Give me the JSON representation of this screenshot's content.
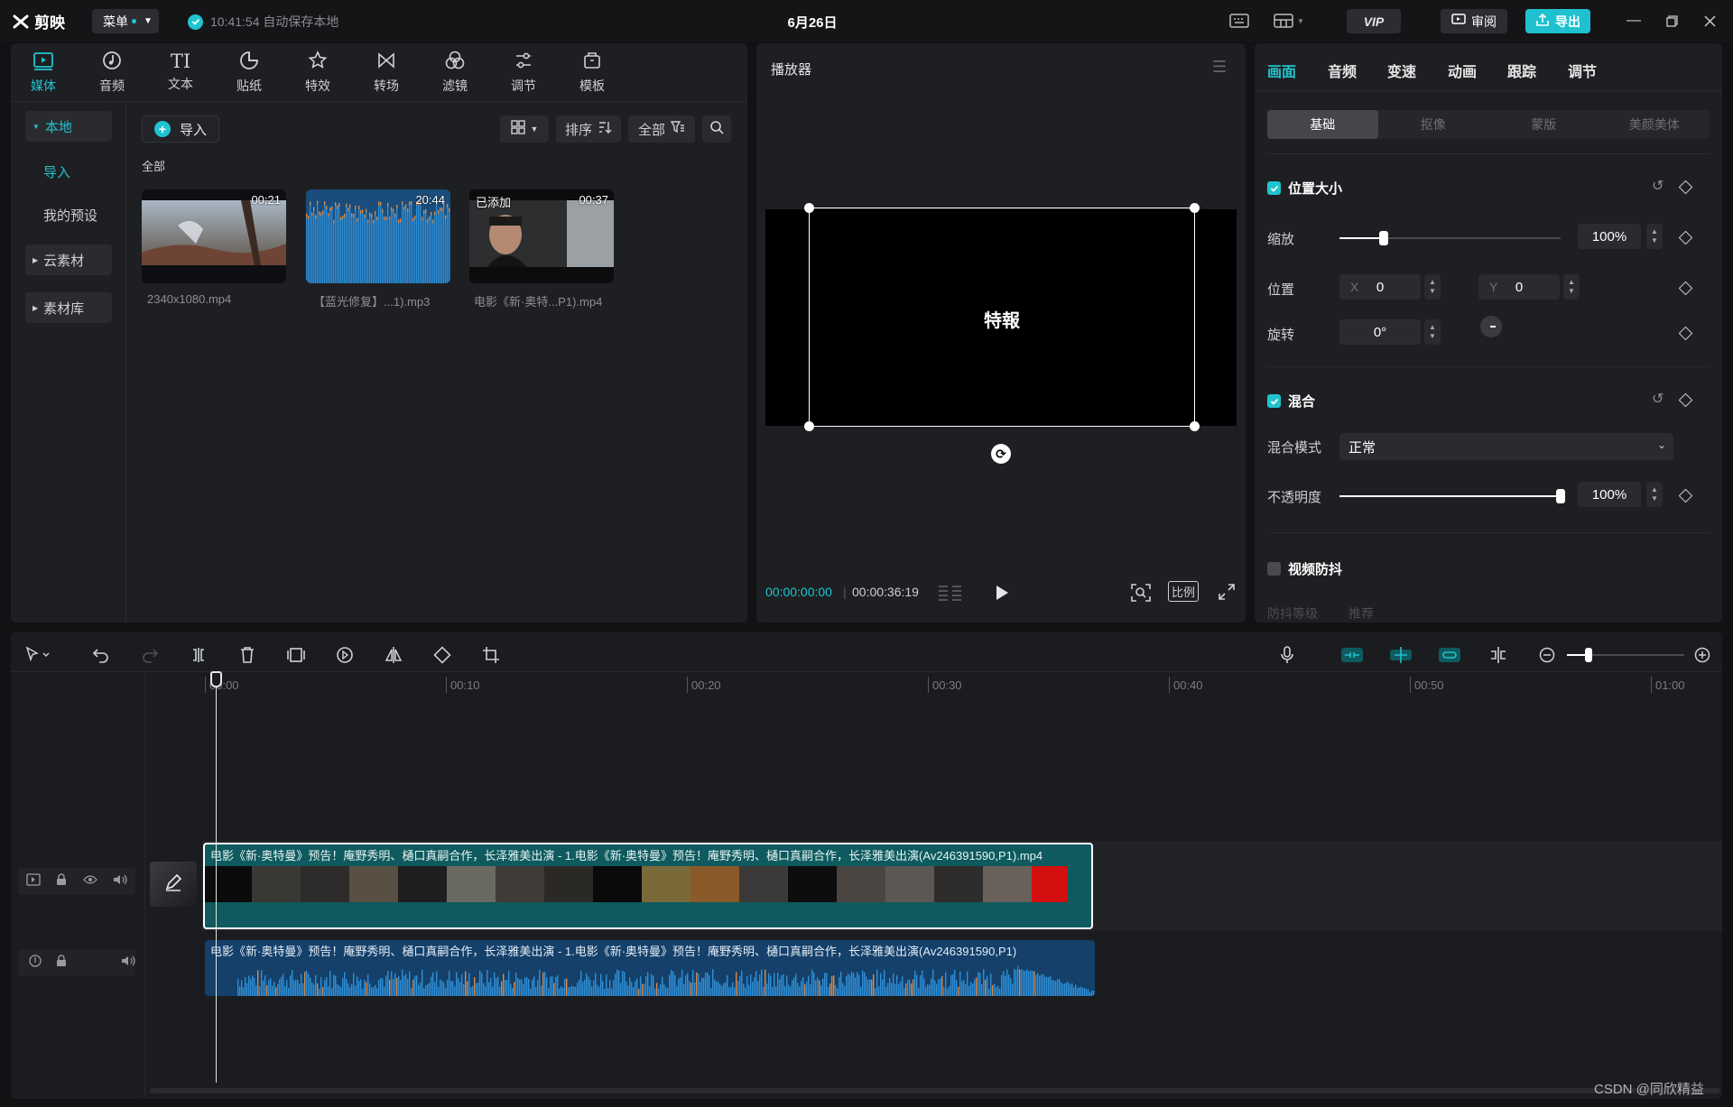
{
  "app": {
    "logo_text": "剪映",
    "menu_label": "菜单",
    "autosave_text": "10:41:54 自动保存本地",
    "project_title": "6月26日",
    "vip_label": "VIP",
    "review_label": "审阅",
    "export_label": "导出",
    "accent_color": "#20c4cf"
  },
  "media": {
    "tools": [
      {
        "label": "媒体",
        "icon": "media-icon"
      },
      {
        "label": "音频",
        "icon": "audio-icon"
      },
      {
        "label": "文本",
        "icon": "text-icon"
      },
      {
        "label": "贴纸",
        "icon": "sticker-icon"
      },
      {
        "label": "特效",
        "icon": "effects-icon"
      },
      {
        "label": "转场",
        "icon": "transition-icon"
      },
      {
        "label": "滤镜",
        "icon": "filter-icon"
      },
      {
        "label": "调节",
        "icon": "adjust-icon"
      },
      {
        "label": "模板",
        "icon": "template-icon"
      }
    ],
    "sidebar": {
      "local": "本地",
      "import": "导入",
      "presets": "我的预设",
      "cloud": "云素材",
      "library": "素材库"
    },
    "import_button": "导入",
    "sort_label": "排序",
    "filter_label": "全部",
    "section_label": "全部",
    "items": [
      {
        "name": "2340x1080.mp4",
        "duration": "00:21",
        "added_badge": ""
      },
      {
        "name": "【蓝光修复】...1).mp3",
        "duration": "20:44",
        "added_badge": ""
      },
      {
        "name": "电影《新·奥特...P1).mp4",
        "duration": "00:37",
        "added_badge": "已添加"
      }
    ]
  },
  "player": {
    "title": "播放器",
    "frame_text": "特報",
    "current_time": "00:00:00:00",
    "total_time": "00:00:36:19",
    "ratio_label": "比例"
  },
  "props": {
    "tabs": [
      "画面",
      "音频",
      "变速",
      "动画",
      "跟踪",
      "调节"
    ],
    "subtabs": [
      "基础",
      "抠像",
      "蒙版",
      "美颜美体"
    ],
    "position_size": {
      "title": "位置大小",
      "scale_label": "缩放",
      "scale_value": "100%",
      "scale_fraction": 0.2,
      "position_label": "位置",
      "x_prefix": "X",
      "x_value": "0",
      "y_prefix": "Y",
      "y_value": "0",
      "rotation_label": "旋转",
      "rotation_value": "0°"
    },
    "blend": {
      "title": "混合",
      "mode_label": "混合模式",
      "mode_value": "正常",
      "opacity_label": "不透明度",
      "opacity_value": "100%",
      "opacity_fraction": 1.0
    },
    "stabilize": {
      "title": "视频防抖",
      "level_label": "防抖等级",
      "level_value": "推荐"
    }
  },
  "timeline": {
    "ruler": [
      "00:00",
      "00:10",
      "00:20",
      "00:30",
      "00:40",
      "00:50",
      "01:00"
    ],
    "video_clip_title": "电影《新·奥特曼》预告！庵野秀明、樋口真嗣合作，长泽雅美出演 - 1.电影《新·奥特曼》预告！庵野秀明、樋口真嗣合作，长泽雅美出演(Av246391590,P1).mp4",
    "audio_clip_title": "电影《新·奥特曼》预告！庵野秀明、樋口真嗣合作，长泽雅美出演 - 1.电影《新·奥特曼》预告！庵野秀明、樋口真嗣合作，长泽雅美出演(Av246391590,P1)"
  },
  "watermark": "CSDN @同欣精益"
}
